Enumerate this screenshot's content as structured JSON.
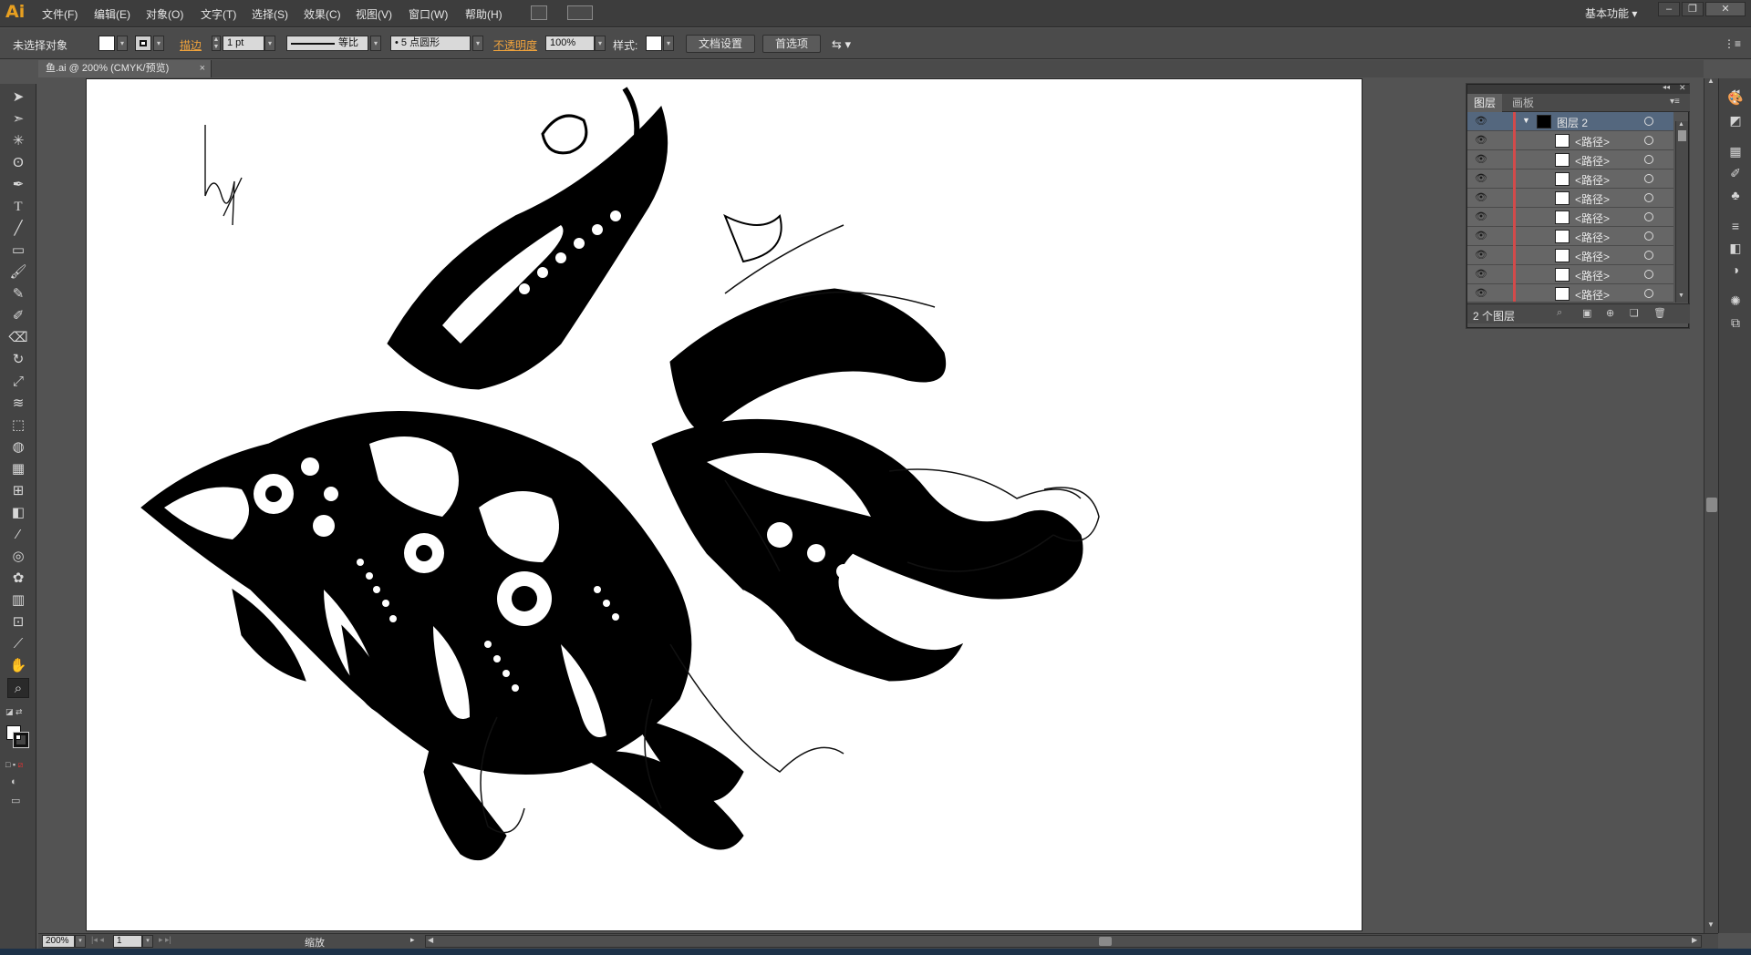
{
  "app": {
    "logo": "Ai"
  },
  "menu": [
    "文件(F)",
    "编辑(E)",
    "对象(O)",
    "文字(T)",
    "选择(S)",
    "效果(C)",
    "视图(V)",
    "窗口(W)",
    "帮助(H)"
  ],
  "workspace": {
    "label": "基本功能",
    "arrow": "▾"
  },
  "window_controls": {
    "minimize": "–",
    "restore": "❐",
    "close": "✕"
  },
  "control": {
    "selection": "未选择对象",
    "stroke_label": "描边",
    "stroke_weight": "1 pt",
    "stroke_profile": "等比",
    "brush": "5 点圆形",
    "opacity_label": "不透明度",
    "opacity_value": "100%",
    "style_label": "样式:",
    "doc_setup": "文档设置",
    "preferences": "首选项"
  },
  "tab": {
    "title": "鱼.ai @ 200% (CMYK/预览)",
    "close": "×"
  },
  "tools": [
    "selection-tool",
    "direct-selection-tool",
    "magic-wand-tool",
    "lasso-tool",
    "pen-tool",
    "type-tool",
    "line-tool",
    "rectangle-tool",
    "paintbrush-tool",
    "pencil-tool",
    "blob-brush-tool",
    "eraser-tool",
    "rotate-tool",
    "scale-tool",
    "warp-tool",
    "free-transform-tool",
    "shape-builder-tool",
    "perspective-grid-tool",
    "mesh-tool",
    "gradient-tool",
    "eyedropper-tool",
    "blend-tool",
    "symbol-sprayer-tool",
    "graph-tool",
    "artboard-tool",
    "slice-tool",
    "hand-tool",
    "zoom-tool"
  ],
  "layers_panel": {
    "tabs": [
      "图层",
      "画板"
    ],
    "parent_layer": "图层 2",
    "path_label": "<路径>",
    "footer": "2 个图层"
  },
  "status": {
    "zoom": "200%",
    "page": "1",
    "info": "缩放"
  }
}
